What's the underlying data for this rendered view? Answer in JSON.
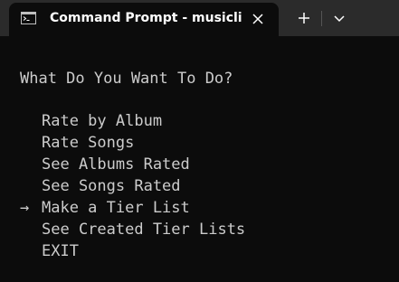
{
  "window": {
    "tab_title": "Command Prompt - musicli",
    "tab_icon": "terminal-icon",
    "close_icon": "close-icon",
    "new_tab_icon": "plus-icon",
    "dropdown_icon": "chevron-down-icon"
  },
  "terminal": {
    "prompt": "What Do You Want To Do?",
    "selector": "→",
    "selected_index": 4,
    "options": [
      {
        "label": "Rate by Album"
      },
      {
        "label": "Rate Songs"
      },
      {
        "label": "See Albums Rated"
      },
      {
        "label": "See Songs Rated"
      },
      {
        "label": "Make a Tier List"
      },
      {
        "label": "See Created Tier Lists"
      },
      {
        "label": "EXIT"
      }
    ]
  },
  "colors": {
    "titlebar": "#2b2b2b",
    "background": "#0c0c0c",
    "text": "#cccccc"
  }
}
